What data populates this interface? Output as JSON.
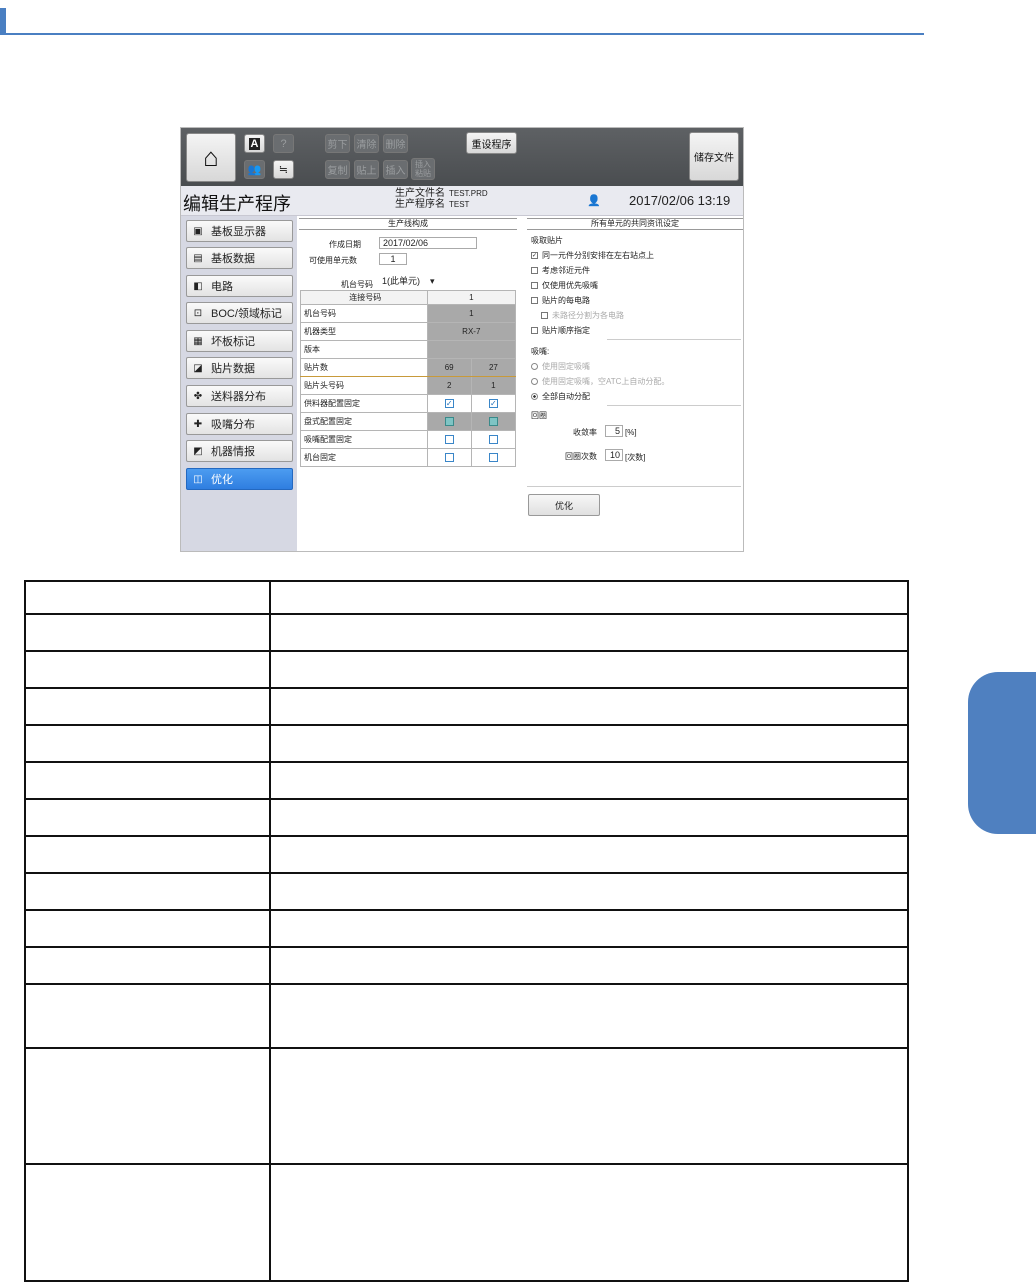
{
  "toolbar": {
    "cut": "剪下",
    "clear": "清除",
    "delete": "删除",
    "copy": "复制",
    "paste": "贴上",
    "insert": "插入",
    "insert_paste_1": "插入",
    "insert_paste_2": "粘贴",
    "reset_program": "重设程序",
    "save_file": "储存文件",
    "help": "?",
    "book": "A"
  },
  "titlebar": {
    "title": "编辑生产程序",
    "file_label": "生产文件名",
    "file_value": "TEST.PRD",
    "program_label": "生产程序名",
    "program_value": "TEST",
    "datetime": "2017/02/06 13:19"
  },
  "sidebar": {
    "items": [
      {
        "label": "基板显示器",
        "icon": "board-display-icon"
      },
      {
        "label": "基板数据",
        "icon": "board-data-icon"
      },
      {
        "label": "电路",
        "icon": "circuit-icon"
      },
      {
        "label": "BOC/领域标记",
        "icon": "boc-mark-icon"
      },
      {
        "label": "坏板标记",
        "icon": "bad-mark-icon"
      },
      {
        "label": "贴片数据",
        "icon": "mount-data-icon"
      },
      {
        "label": "送料器分布",
        "icon": "feeder-icon"
      },
      {
        "label": "吸嘴分布",
        "icon": "nozzle-icon"
      },
      {
        "label": "机器情报",
        "icon": "machine-info-icon"
      },
      {
        "label": "优化",
        "icon": "optimize-icon"
      }
    ]
  },
  "left_panel": {
    "header": "生产线构成",
    "date_label": "作成日期",
    "date_value": "2017/02/06",
    "units_label": "可使用单元数",
    "units_value": "1",
    "machine_no_label": "机台号码",
    "machine_no_value": "1(此单元)",
    "grid": {
      "header_label": "连接号码",
      "header_value": "1",
      "rows": [
        {
          "label": "机台号码",
          "v1": "1",
          "v2": ""
        },
        {
          "label": "机器类型",
          "v1": "RX-7",
          "v2": ""
        },
        {
          "label": "版本",
          "v1": "",
          "v2": ""
        },
        {
          "label": "贴片数",
          "v1": "69",
          "v2": "27"
        },
        {
          "label": "贴片头号码",
          "v1": "2",
          "v2": "1"
        },
        {
          "label": "供料器配置固定",
          "v1": "✓",
          "v2": "✓"
        },
        {
          "label": "盘式配置固定",
          "v1": "",
          "v2": ""
        },
        {
          "label": "吸嘴配置固定",
          "v1": "",
          "v2": ""
        },
        {
          "label": "机台固定",
          "v1": "",
          "v2": ""
        }
      ]
    }
  },
  "right_panel": {
    "header": "所有单元的共同资讯设定",
    "pickup_title": "吸取贴片",
    "pickup_opts": [
      {
        "label": "同一元件分别安排在左右站点上",
        "checked": "✓"
      },
      {
        "label": "考虑邻近元件",
        "checked": ""
      },
      {
        "label": "仅使用优先吸嘴",
        "checked": ""
      },
      {
        "label": "贴片的每电路",
        "checked": ""
      },
      {
        "label": "未路径分割为各电路",
        "checked": ""
      },
      {
        "label": "贴片顺序指定",
        "checked": ""
      }
    ],
    "nozzle_title": "吸嘴:",
    "nozzle_opts": [
      {
        "label": "使用固定吸嘴"
      },
      {
        "label": "使用固定吸嘴，空ATC上自动分配。"
      },
      {
        "label": "全部自动分配"
      }
    ],
    "loop_title": "回圈",
    "convergence_label": "收敛率",
    "convergence_value": "5",
    "convergence_unit": "[%]",
    "loop_count_label": "回圈次数",
    "loop_count_value": "10",
    "loop_count_unit": "[次数]",
    "optimize_button": "优化"
  }
}
